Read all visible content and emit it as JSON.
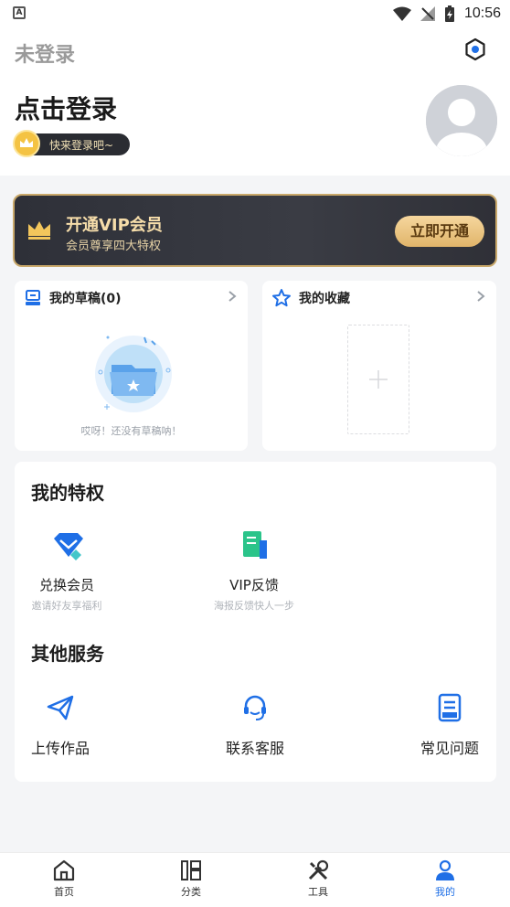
{
  "status_bar": {
    "left_icon": "A",
    "time": "10:56"
  },
  "header": {
    "unlogged_label": "未登录",
    "login_title": "点击登录",
    "login_hint": "快来登录吧~"
  },
  "vip": {
    "title": "开通VIP会员",
    "subtitle": "会员尊享四大特权",
    "button": "立即开通"
  },
  "drafts": {
    "title": "我的草稿(0)",
    "empty_text": "哎呀！还没有草稿呐！"
  },
  "favorites": {
    "title": "我的收藏"
  },
  "privileges": {
    "title": "我的特权",
    "items": [
      {
        "label": "兑换会员",
        "sub": "邀请好友享福利",
        "icon": "gem-icon"
      },
      {
        "label": "VIP反馈",
        "sub": "海报反馈快人一步",
        "icon": "feedback-doc-icon"
      }
    ]
  },
  "other_services": {
    "title": "其他服务",
    "items": [
      {
        "label": "上传作品",
        "icon": "paper-plane-icon"
      },
      {
        "label": "联系客服",
        "icon": "headset-icon"
      },
      {
        "label": "常见问题",
        "icon": "faq-doc-icon"
      }
    ]
  },
  "tabbar": {
    "tabs": [
      {
        "label": "首页",
        "icon": "home-icon",
        "active": false
      },
      {
        "label": "分类",
        "icon": "category-icon",
        "active": false
      },
      {
        "label": "工具",
        "icon": "tools-icon",
        "active": false
      },
      {
        "label": "我的",
        "icon": "profile-icon",
        "active": true
      }
    ]
  },
  "colors": {
    "accent": "#1f6fe6",
    "vip_gold": "#f6ddaa",
    "vip_dark": "#2e3038"
  }
}
